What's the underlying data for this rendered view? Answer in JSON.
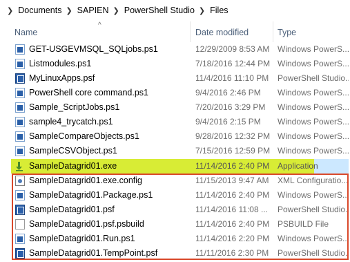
{
  "breadcrumb": [
    "Documents",
    "SAPIEN",
    "PowerShell Studio",
    "Files"
  ],
  "columns": {
    "name": "Name",
    "date": "Date modified",
    "type": "Type"
  },
  "sort_indicator": "^",
  "rows": [
    {
      "name": "GET-USGEVMSQL_SQLjobs.ps1",
      "date": "12/29/2009 8:53 AM",
      "type": "Windows PowerS...",
      "icon": "ps1-file-icon"
    },
    {
      "name": "Listmodules.ps1",
      "date": "7/18/2016 12:44 PM",
      "type": "Windows PowerS...",
      "icon": "ps1-file-icon"
    },
    {
      "name": "MyLinuxApps.psf",
      "date": "11/4/2016 11:10 PM",
      "type": "PowerShell Studio...",
      "icon": "psf-file-icon"
    },
    {
      "name": "PowerShell core command.ps1",
      "date": "9/4/2016 2:46 PM",
      "type": "Windows PowerS...",
      "icon": "ps1-file-icon"
    },
    {
      "name": "Sample_ScriptJobs.ps1",
      "date": "7/20/2016 3:29 PM",
      "type": "Windows PowerS...",
      "icon": "ps1-file-icon"
    },
    {
      "name": "sample4_trycatch.ps1",
      "date": "9/4/2016 2:15 PM",
      "type": "Windows PowerS...",
      "icon": "ps1-file-icon"
    },
    {
      "name": "SampleCompareObjects.ps1",
      "date": "9/28/2016 12:32 PM",
      "type": "Windows PowerS...",
      "icon": "ps1-file-icon"
    },
    {
      "name": "SampleCSVObject.ps1",
      "date": "7/15/2016 12:59 PM",
      "type": "Windows PowerS...",
      "icon": "ps1-file-icon"
    },
    {
      "name": "SampleDatagrid01.exe",
      "date": "11/14/2016 2:40 PM",
      "type": "Application",
      "icon": "exe-file-icon"
    },
    {
      "name": "SampleDatagrid01.exe.config",
      "date": "11/15/2013 9:47 AM",
      "type": "XML Configuratio...",
      "icon": "config-file-icon"
    },
    {
      "name": "SampleDatagrid01.Package.ps1",
      "date": "11/14/2016 2:40 PM",
      "type": "Windows PowerS...",
      "icon": "ps1-file-icon"
    },
    {
      "name": "SampleDatagrid01.psf",
      "date": "11/14/2016 11:08 ...",
      "type": "PowerShell Studio...",
      "icon": "psf-file-icon"
    },
    {
      "name": "SampleDatagrid01.psf.psbuild",
      "date": "11/14/2016 2:40 PM",
      "type": "PSBUILD File",
      "icon": "generic-file-icon"
    },
    {
      "name": "SampleDatagrid01.Run.ps1",
      "date": "11/14/2016 2:20 PM",
      "type": "Windows PowerS...",
      "icon": "ps1-file-icon"
    },
    {
      "name": "SampleDatagrid01.TempPoint.psf",
      "date": "11/11/2016 2:30 PM",
      "type": "PowerShell Studio...",
      "icon": "psf-file-icon"
    }
  ],
  "colors": {
    "highlight": "#d8ec35",
    "selection": "#cce8ff",
    "annotation_box": "#d9482a"
  }
}
